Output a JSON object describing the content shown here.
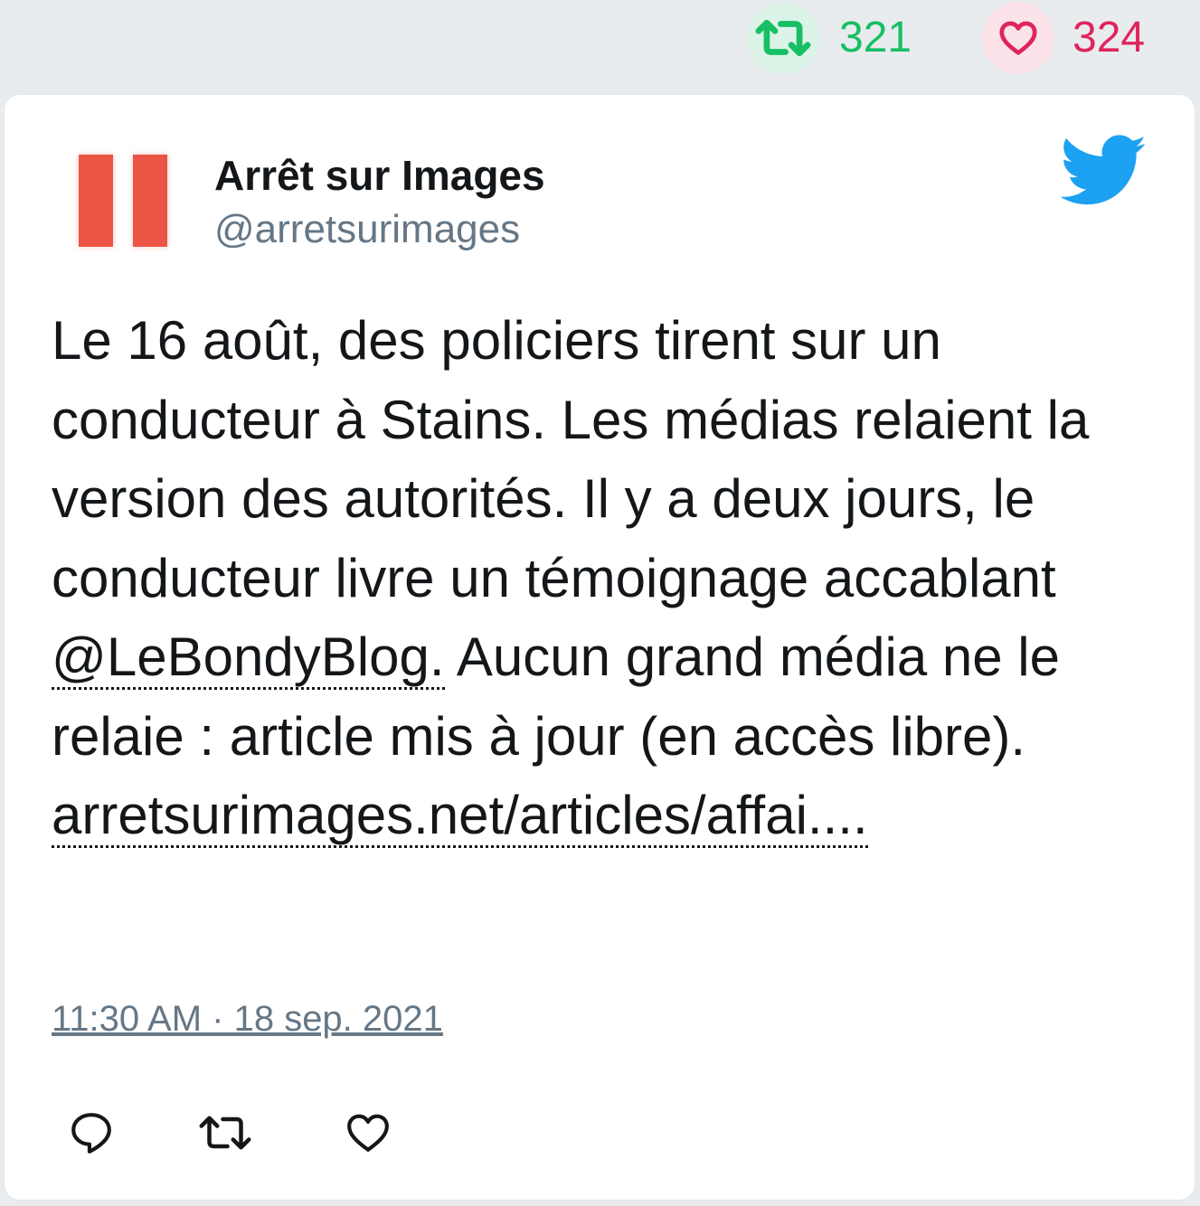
{
  "stats": {
    "retweets": "321",
    "likes": "324",
    "retweet_color": "#17bf63",
    "like_color": "#e0245e",
    "retweet_icon": "retweet-icon",
    "like_icon": "heart-icon"
  },
  "tweet": {
    "author_name": "Arrêt sur Images",
    "author_handle": "@arretsurimages",
    "text_part1": "Le 16 août, des policiers tirent sur un conducteur à Stains. Les médias relaient la version des autorités. Il y a deux jours, le conducteur livre un témoignage accablant ",
    "mention": "@LeBondyBlog.",
    "text_part2": " Aucun grand média ne le relaie : article mis à jour (en accès libre).",
    "link": "arretsurimages.net/articles/affai....",
    "timestamp": "11:30 AM · 18 sep. 2021",
    "brand_icon": "twitter-bird-icon",
    "brand_color": "#1da1f2",
    "avatar_color": "#ea5545"
  },
  "actions": {
    "reply_icon": "reply-icon",
    "retweet_icon": "retweet-icon",
    "like_icon": "heart-icon"
  }
}
